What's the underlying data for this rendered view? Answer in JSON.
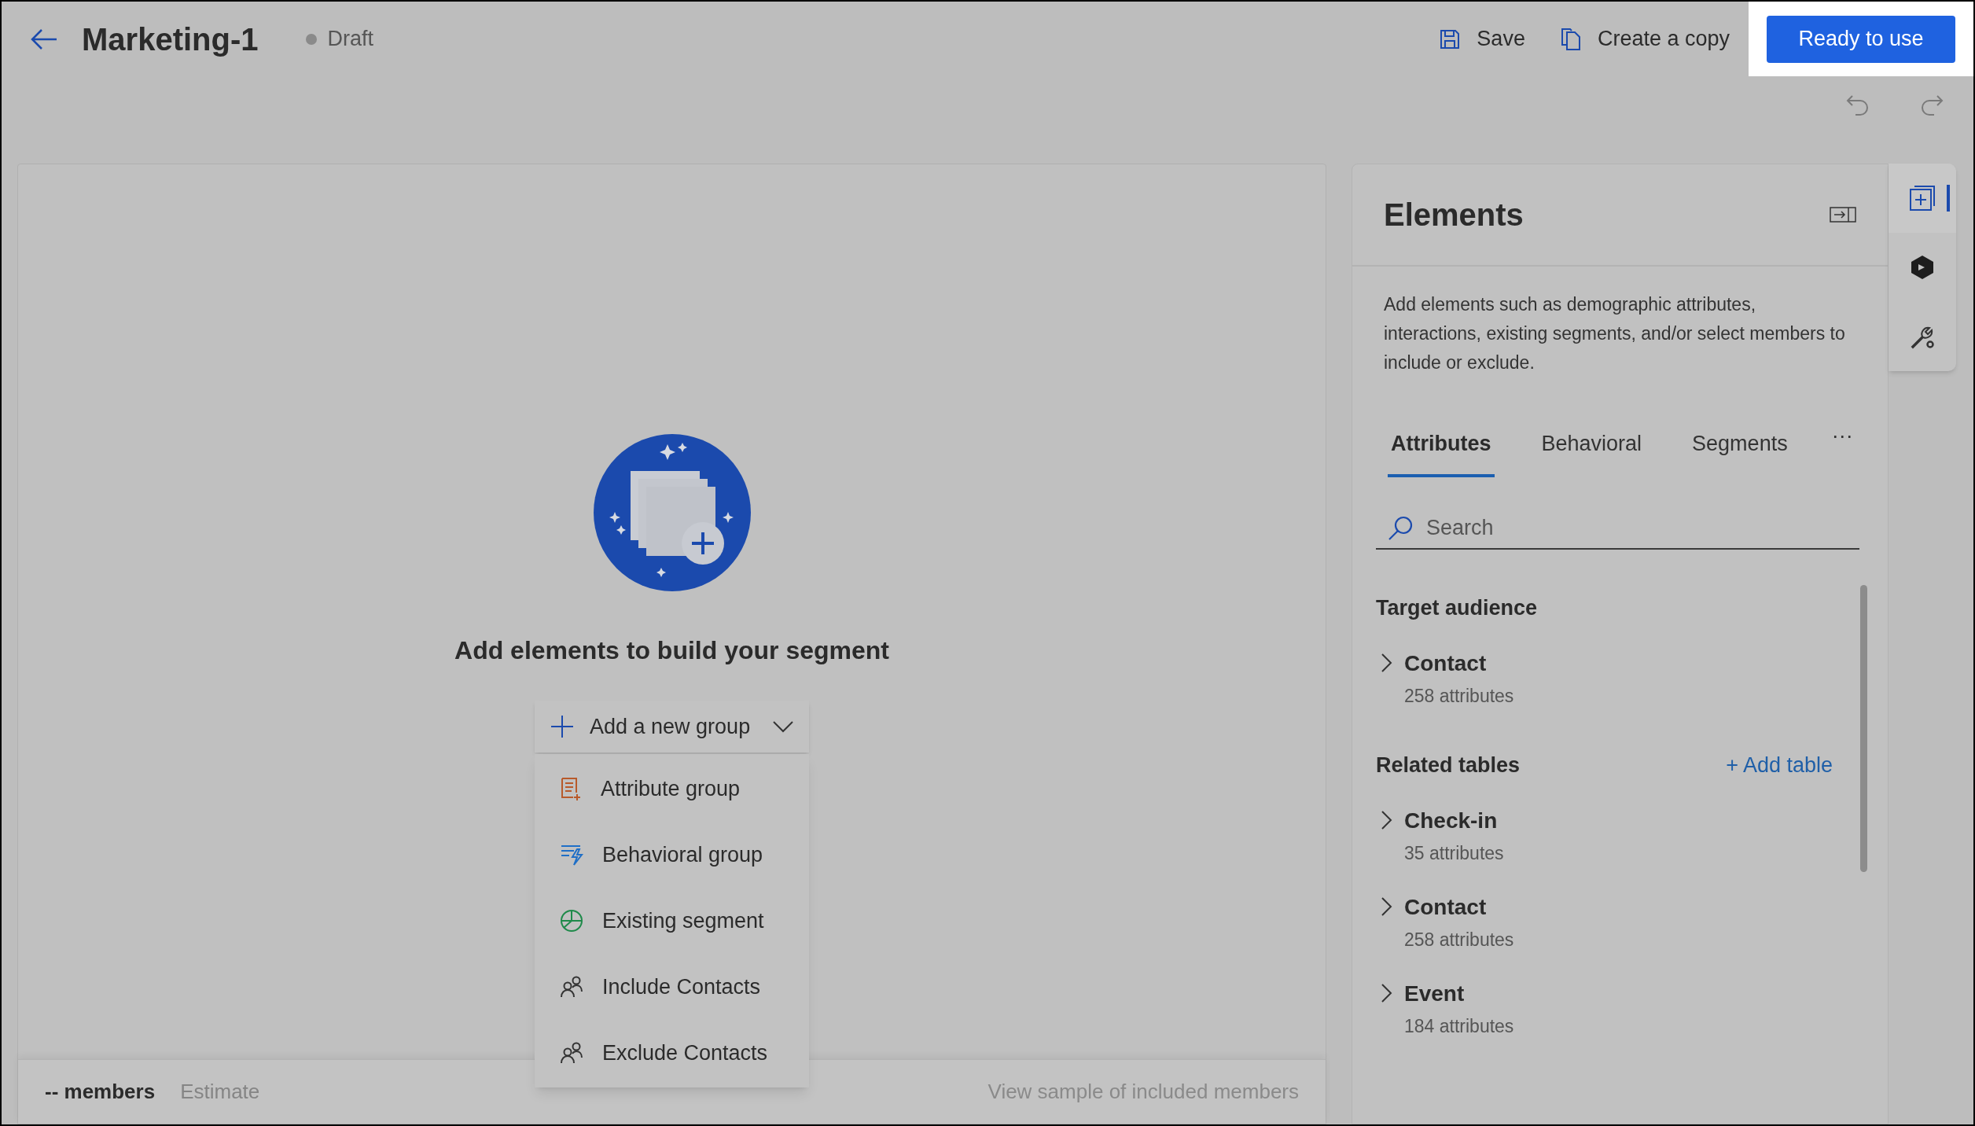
{
  "header": {
    "title": "Marketing-1",
    "status": "Draft",
    "actions": [
      {
        "kind": "save",
        "label": "Save"
      },
      {
        "kind": "copy",
        "label": "Create a copy"
      }
    ],
    "primary": "Ready to use"
  },
  "canvas": {
    "heading": "Add elements to build your segment",
    "add_button": "Add a new group",
    "menu": [
      {
        "kind": "attribute",
        "label": "Attribute group"
      },
      {
        "kind": "behavioral",
        "label": "Behavioral group"
      },
      {
        "kind": "segment",
        "label": "Existing segment"
      },
      {
        "kind": "include",
        "label": "Include Contacts"
      },
      {
        "kind": "exclude",
        "label": "Exclude Contacts"
      }
    ],
    "footer": {
      "members": "-- members",
      "estimate": "Estimate",
      "link": "View sample of included members"
    }
  },
  "panel": {
    "title": "Elements",
    "description": "Add elements such as demographic attributes, interactions, existing segments, and/or select members to include or exclude.",
    "tabs": [
      {
        "label": "Attributes",
        "selected": true
      },
      {
        "label": "Behavioral",
        "selected": false
      },
      {
        "label": "Segments",
        "selected": false
      }
    ],
    "more": "···",
    "search": {
      "placeholder": "Search"
    },
    "sections": [
      {
        "title": "Target audience",
        "items": [
          {
            "name": "Contact",
            "count": "258 attributes"
          }
        ]
      },
      {
        "title": "Related tables",
        "action": "+ Add table",
        "items": [
          {
            "name": "Check-in",
            "count": "35 attributes"
          },
          {
            "name": "Contact",
            "count": "258 attributes"
          },
          {
            "name": "Event",
            "count": "184 attributes"
          }
        ]
      }
    ]
  },
  "rail": [
    {
      "kind": "elements",
      "selected": true
    },
    {
      "kind": "copilot",
      "selected": false
    },
    {
      "kind": "tools",
      "selected": false
    }
  ]
}
